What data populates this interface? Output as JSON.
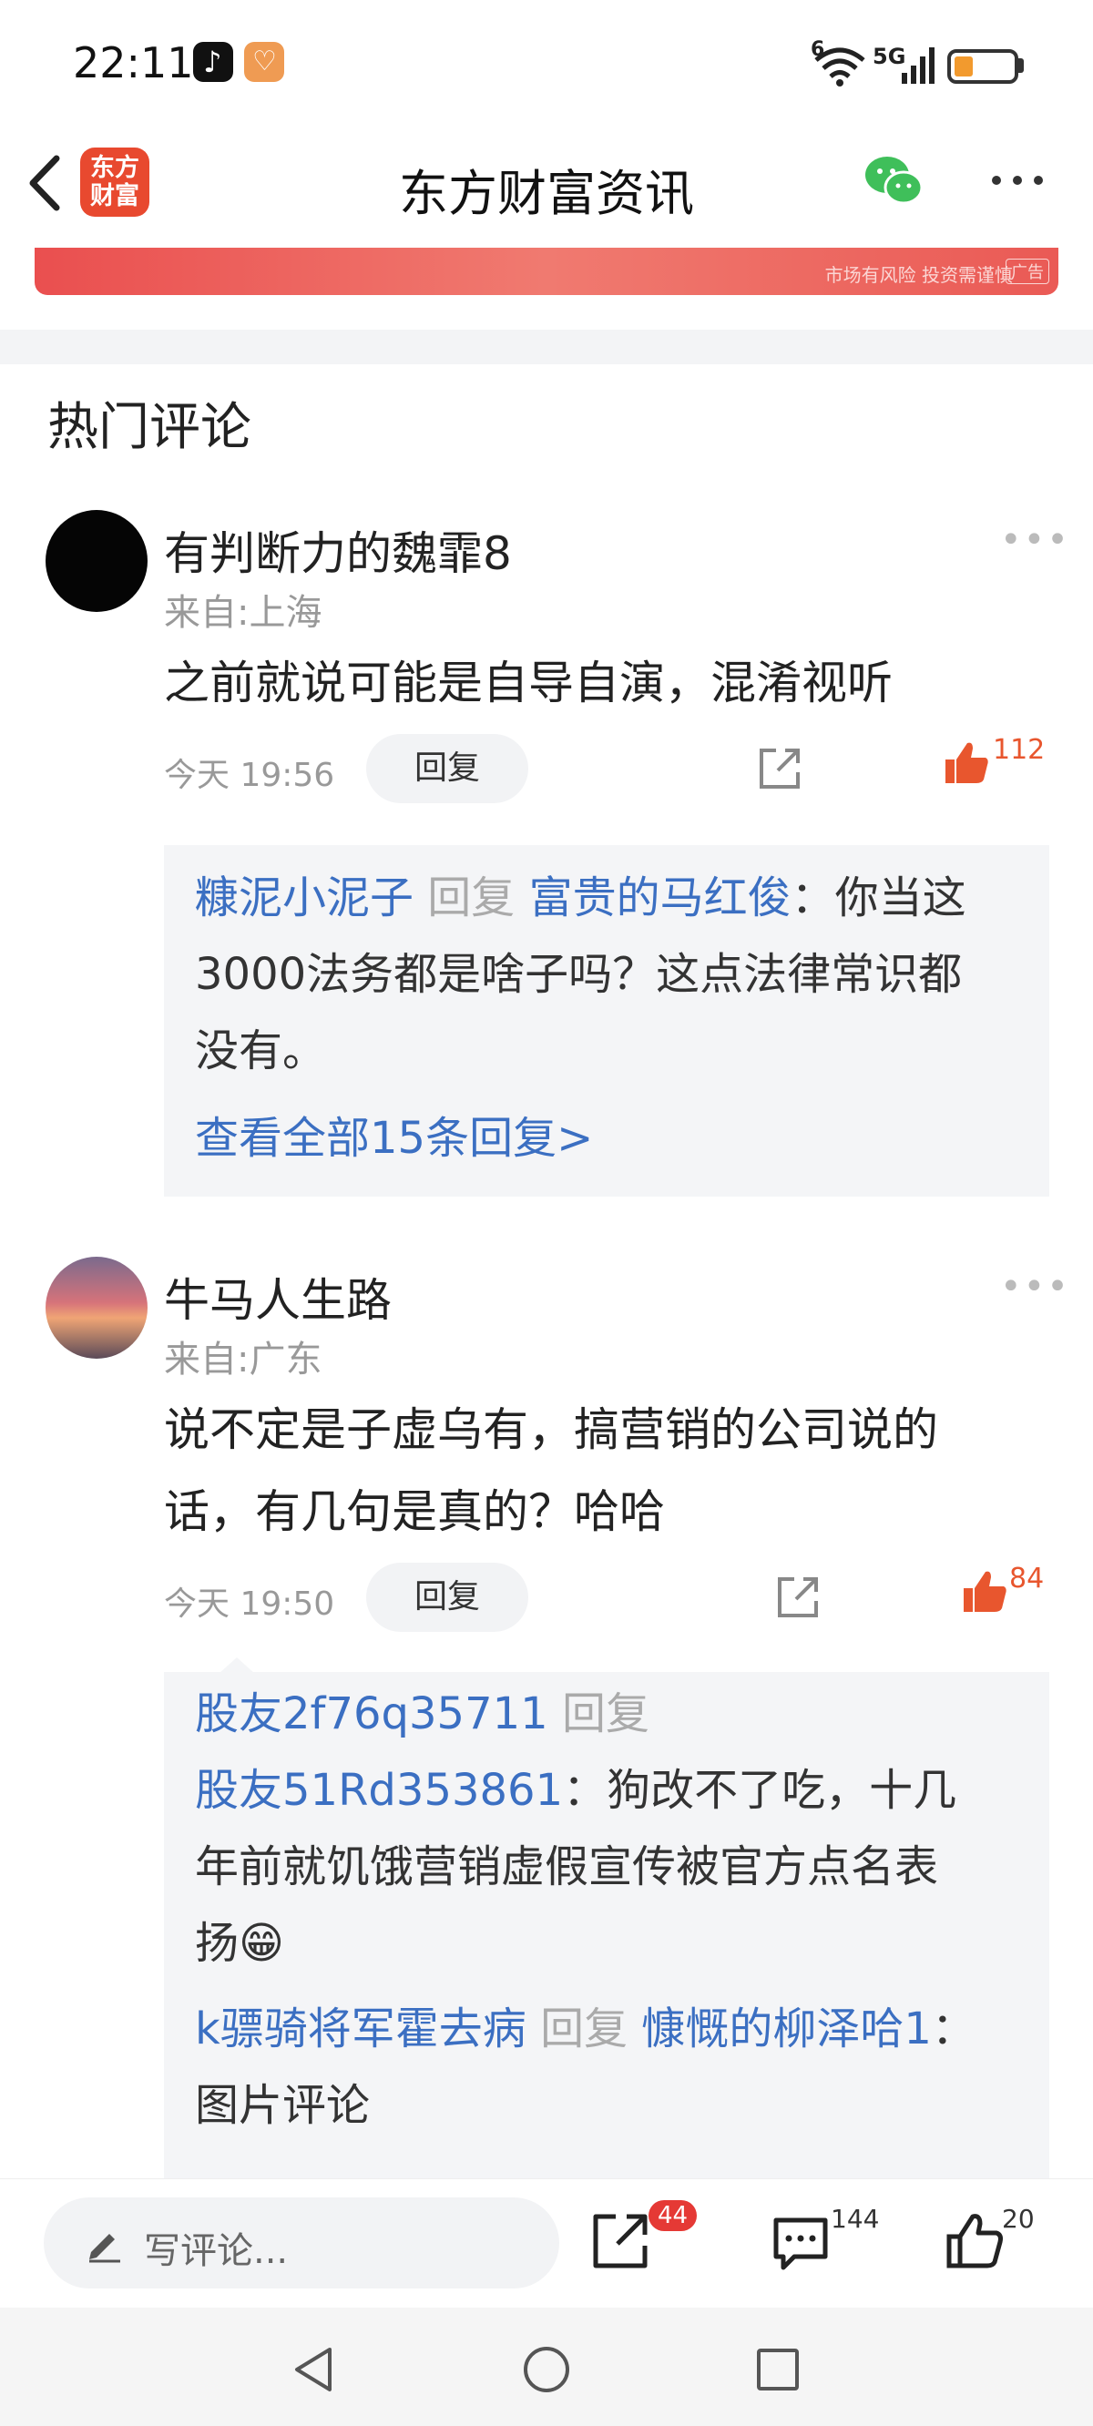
{
  "status_bar": {
    "time": "22:11",
    "network": "5G",
    "signal_level": "6",
    "battery_level": 0.25
  },
  "header": {
    "title": "东方财富资讯",
    "logo_line1": "东方",
    "logo_line2": "财富"
  },
  "banner": {
    "text": "市场有风险 投资需谨慎",
    "tag": "广告"
  },
  "section_title": "热门评论",
  "comments": [
    {
      "username": "有判断力的魏霏8",
      "location": "来自:上海",
      "content": "之前就说可能是自导自演，混淆视听",
      "timestamp": "今天 19:56",
      "reply_label": "回复",
      "likes": "112",
      "replies": [
        {
          "author": "糠泥小泥子",
          "reply_word": "回复",
          "target": "富贵的马红俊",
          "colon": "：",
          "text_line1": "你当这",
          "text_line2": "3000法务都是啥子吗？这点法律常识都",
          "text_line3": "没有。"
        }
      ],
      "view_all": "查看全部15条回复>"
    },
    {
      "username": "牛马人生路",
      "location": "来自:广东",
      "content_line1": "说不定是子虚乌有，搞营销的公司说的",
      "content_line2": "话，有几句是真的？哈哈",
      "timestamp": "今天 19:50",
      "reply_label": "回复",
      "likes": "84",
      "replies": [
        {
          "author": "股友2f76q35711",
          "reply_word": "回复",
          "target": "股友51Rd353861",
          "colon": "：",
          "text_line1": "狗改不了吃，十几",
          "text_line2": "年前就饥饿营销虚假宣传被官方点名表",
          "text_line3": "扬😁"
        },
        {
          "author": "k骠骑将军霍去病",
          "reply_word": "回复",
          "target": "慷慨的柳泽哈1",
          "colon": "：",
          "text_line1": "图片评论"
        }
      ]
    }
  ],
  "bottom_bar": {
    "input_placeholder": "写评论...",
    "share_count": "44",
    "comment_count": "144",
    "like_count": "20"
  },
  "icons": {
    "back": "back-arrow-icon",
    "wechat": "wechat-icon",
    "more": "more-dots-icon",
    "share": "share-icon",
    "like": "thumbs-up-icon",
    "comment": "comment-icon",
    "pen": "pen-icon"
  },
  "colors": {
    "brand_red": "#e8492f",
    "link_blue": "#3b6fc2",
    "like_orange": "#e8562e",
    "badge_red": "#e53935"
  }
}
